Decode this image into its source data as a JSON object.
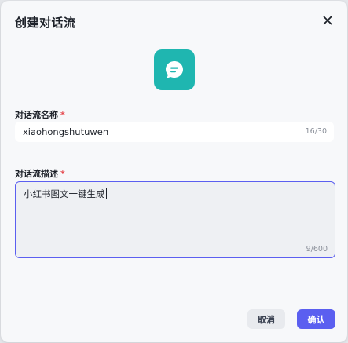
{
  "dialog": {
    "title": "创建对话流",
    "close_icon": "close-icon"
  },
  "app_icon": {
    "name": "chat-bubble-icon",
    "color": "#1fb6b0"
  },
  "name_field": {
    "label": "对话流名称",
    "required_mark": "*",
    "value": "xiaohongshutuwen",
    "counter": "16/30"
  },
  "description_field": {
    "label": "对话流描述",
    "required_mark": "*",
    "value": "小红书图文一键生成",
    "counter": "9/600"
  },
  "buttons": {
    "cancel_label": "取消",
    "confirm_label": "确认"
  },
  "colors": {
    "accent": "#5b5ff0",
    "required": "#e5484d"
  }
}
